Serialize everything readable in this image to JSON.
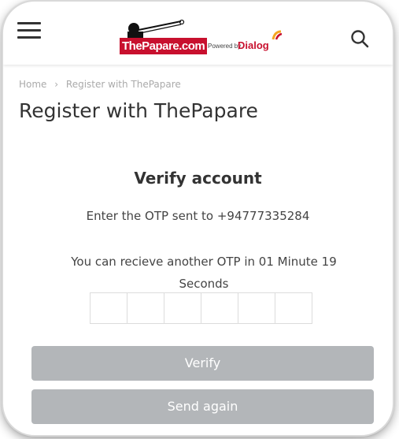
{
  "header": {
    "logo": {
      "brand": "ThePapare.com",
      "powered_by": "Powered by",
      "partner": "Dialog"
    },
    "menu_icon": "hamburger-menu-icon",
    "search_icon": "search-icon"
  },
  "breadcrumb": {
    "items": [
      "Home",
      "Register with ThePapare"
    ],
    "separator": "›"
  },
  "page": {
    "title": "Register with ThePapare"
  },
  "verify": {
    "heading": "Verify account",
    "otp_sent": "Enter the OTP sent to +94777335284",
    "resend_line1": "You can recieve another OTP in 01 Minute 19",
    "resend_line2": "Seconds",
    "otp_digit_count": 6,
    "verify_label": "Verify",
    "send_again_label": "Send again"
  },
  "colors": {
    "brand_red": "#c8102e",
    "button_disabled": "#b3b6b9",
    "text": "#333333"
  }
}
